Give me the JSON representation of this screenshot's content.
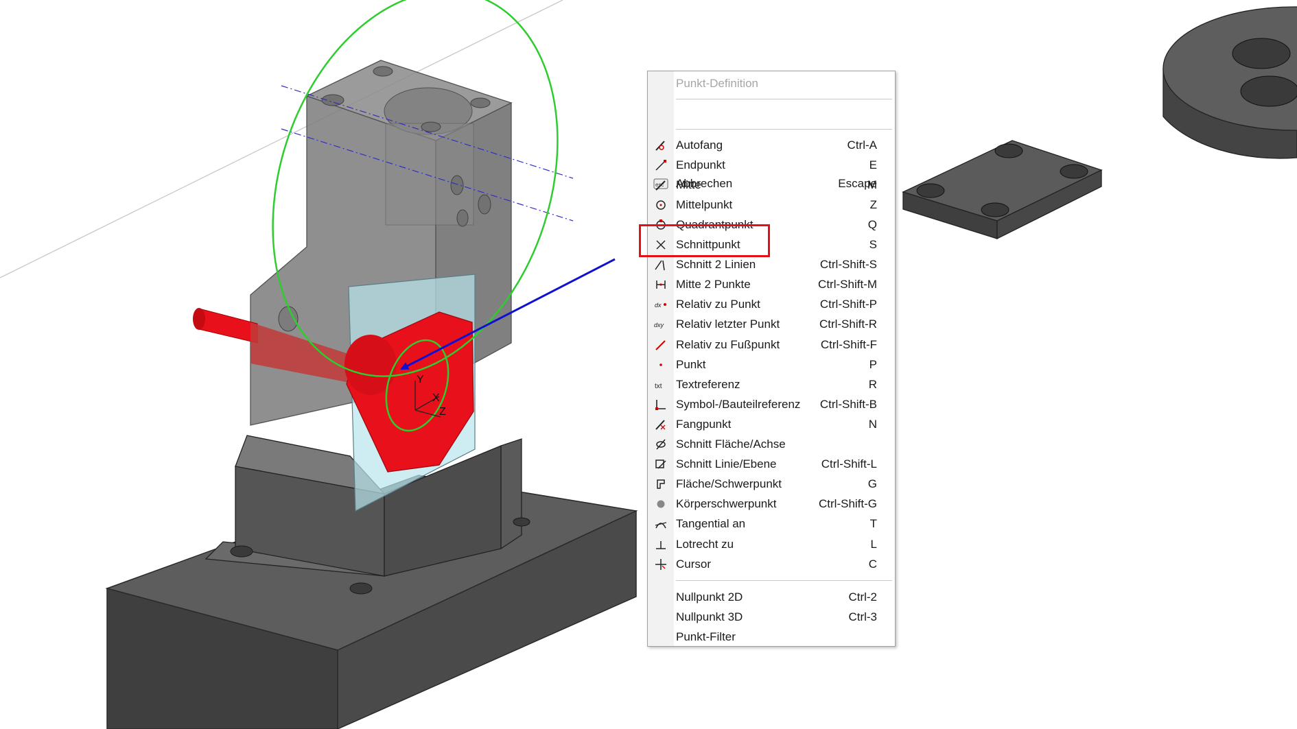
{
  "menu": {
    "title": "Punkt-Definition",
    "cancel": {
      "label": "Abbrechen",
      "shortcut": "Escape",
      "icon": "esc-icon"
    },
    "snap_items": [
      {
        "label": "Autofang",
        "shortcut": "Ctrl-A",
        "icon": "autofang-icon"
      },
      {
        "label": "Endpunkt",
        "shortcut": "E",
        "icon": "endpoint-icon"
      },
      {
        "label": "Mitte",
        "shortcut": "M",
        "icon": "midpoint-icon"
      },
      {
        "label": "Mittelpunkt",
        "shortcut": "Z",
        "icon": "center-icon"
      },
      {
        "label": "Quadrantpunkt",
        "shortcut": "Q",
        "icon": "quadrant-icon"
      },
      {
        "label": "Schnittpunkt",
        "shortcut": "S",
        "icon": "intersection-icon"
      },
      {
        "label": "Schnitt 2 Linien",
        "shortcut": "Ctrl-Shift-S",
        "icon": "intersect-lines-icon"
      },
      {
        "label": "Mitte 2 Punkte",
        "shortcut": "Ctrl-Shift-M",
        "icon": "mid-two-points-icon"
      },
      {
        "label": "Relativ zu Punkt",
        "shortcut": "Ctrl-Shift-P",
        "icon": "relative-point-icon"
      },
      {
        "label": "Relativ letzter Punkt",
        "shortcut": "Ctrl-Shift-R",
        "icon": "relative-last-icon"
      },
      {
        "label": "Relativ zu Fußpunkt",
        "shortcut": "Ctrl-Shift-F",
        "icon": "relative-foot-icon"
      },
      {
        "label": "Punkt",
        "shortcut": "P",
        "icon": "point-icon"
      },
      {
        "label": "Textreferenz",
        "shortcut": "R",
        "icon": "text-reference-icon"
      },
      {
        "label": "Symbol-/Bauteilreferenz",
        "shortcut": "Ctrl-Shift-B",
        "icon": "symbol-reference-icon"
      },
      {
        "label": "Fangpunkt",
        "shortcut": "N",
        "icon": "snap-point-icon"
      },
      {
        "label": "Schnitt Fläche/Achse",
        "shortcut": "",
        "icon": "surface-axis-icon"
      },
      {
        "label": "Schnitt Linie/Ebene",
        "shortcut": "Ctrl-Shift-L",
        "icon": "line-plane-icon"
      },
      {
        "label": "Fläche/Schwerpunkt",
        "shortcut": "G",
        "icon": "surface-centroid-icon"
      },
      {
        "label": "Körperschwerpunkt",
        "shortcut": "Ctrl-Shift-G",
        "icon": "body-centroid-icon"
      },
      {
        "label": "Tangential an",
        "shortcut": "T",
        "icon": "tangent-icon"
      },
      {
        "label": "Lotrecht zu",
        "shortcut": "L",
        "icon": "perpendicular-icon"
      },
      {
        "label": "Cursor",
        "shortcut": "C",
        "icon": "cursor-icon"
      }
    ],
    "origin_items": [
      {
        "label": "Nullpunkt 2D",
        "shortcut": "Ctrl-2"
      },
      {
        "label": "Nullpunkt 3D",
        "shortcut": "Ctrl-3"
      },
      {
        "label": "Punkt-Filter",
        "shortcut": ""
      }
    ]
  },
  "viewport": {
    "axis_labels": {
      "y": "Y",
      "x": "X",
      "z": "Z"
    }
  },
  "colors": {
    "highlight_box": "#e3101b",
    "arrow": "#1010d0",
    "selection_ring": "#2ecc2e",
    "selected_part": "#e8111b",
    "part_dark": "#4a4a4a"
  }
}
